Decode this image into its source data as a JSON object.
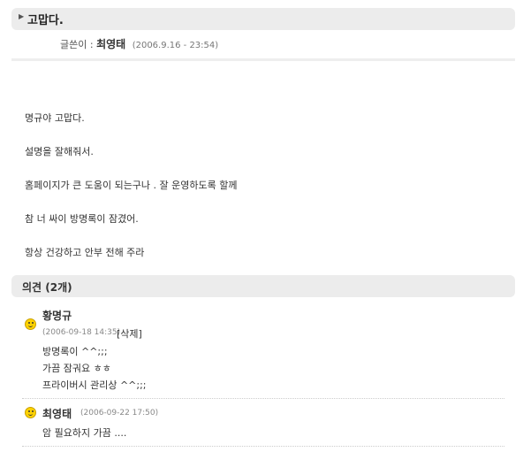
{
  "post": {
    "title": "고맙다.",
    "author_label": "글쓴이 :",
    "author": "최영태",
    "date": "(2006.9.16 - 23:54)",
    "lines": [
      "명규야 고맙다.",
      "설명을 잘해줘서.",
      "홈페이지가 큰 도움이 되는구나 .  잘 운영하도록 할께",
      "참 너 싸이 방명록이 잠겼어.",
      "항상 건강하고 안부  전해 주라"
    ]
  },
  "comments": {
    "header": "의견 (2개)",
    "items": [
      {
        "author": "황명규",
        "date": "(2006-09-18  14:35)",
        "delete_label": "[삭제]",
        "lines": [
          "방명록이 ^^;;;",
          "가끔 잠궈요 ㅎㅎ",
          "프라이버시 관리상 ^^;;;"
        ]
      },
      {
        "author": "최영태",
        "date": "(2006-09-22  17:50)",
        "lines": [
          "암 필요하지 가끔 ...."
        ]
      }
    ]
  },
  "icons": {
    "caret": "caret-right-icon",
    "avatar": "smiley-icon"
  }
}
